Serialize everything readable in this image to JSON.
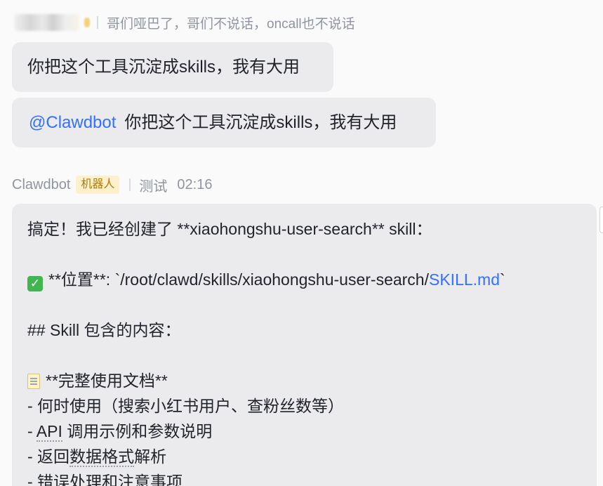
{
  "quote": {
    "text": "哥们哑巴了，哥们不说话，oncall也不说话"
  },
  "messages": [
    {
      "text": "你把这个工具沉淀成skills，我有大用"
    },
    {
      "mention": "@Clawdbot",
      "text": "你把这个工具沉淀成skills，我有大用"
    }
  ],
  "reply": {
    "sender": "Clawdbot",
    "badge": "机器人",
    "group": "测试",
    "time": "02:16",
    "line1": "搞定！我已经创建了 **xiaohongshu-user-search** skill：",
    "location_prefix": "**位置**: `/root/clawd/skills/xiaohongshu-user-search/",
    "location_link": "SKILL.md",
    "location_suffix": "`",
    "section_heading": "## Skill 包含的内容：",
    "doc_title": "**完整使用文档**",
    "item1": "- 何时使用（搜索小红书用户、查粉丝数等）",
    "item2_prefix": "- ",
    "item2_dotted": "API",
    "item2_rest": " 调用示例和参数说明",
    "item3_prefix": "- 返回",
    "item3_dotted": "数据格式",
    "item3_rest": "解析",
    "item4": "- 错误处理和注意事项"
  },
  "icons": [
    "check-emoji-icon",
    "memo-emoji-icon"
  ],
  "colors": {
    "link": "#3370ff",
    "bubble": "#ebebed",
    "badge_bg": "#fdf0cc",
    "badge_text": "#b07b06",
    "meta": "#8f959e"
  }
}
